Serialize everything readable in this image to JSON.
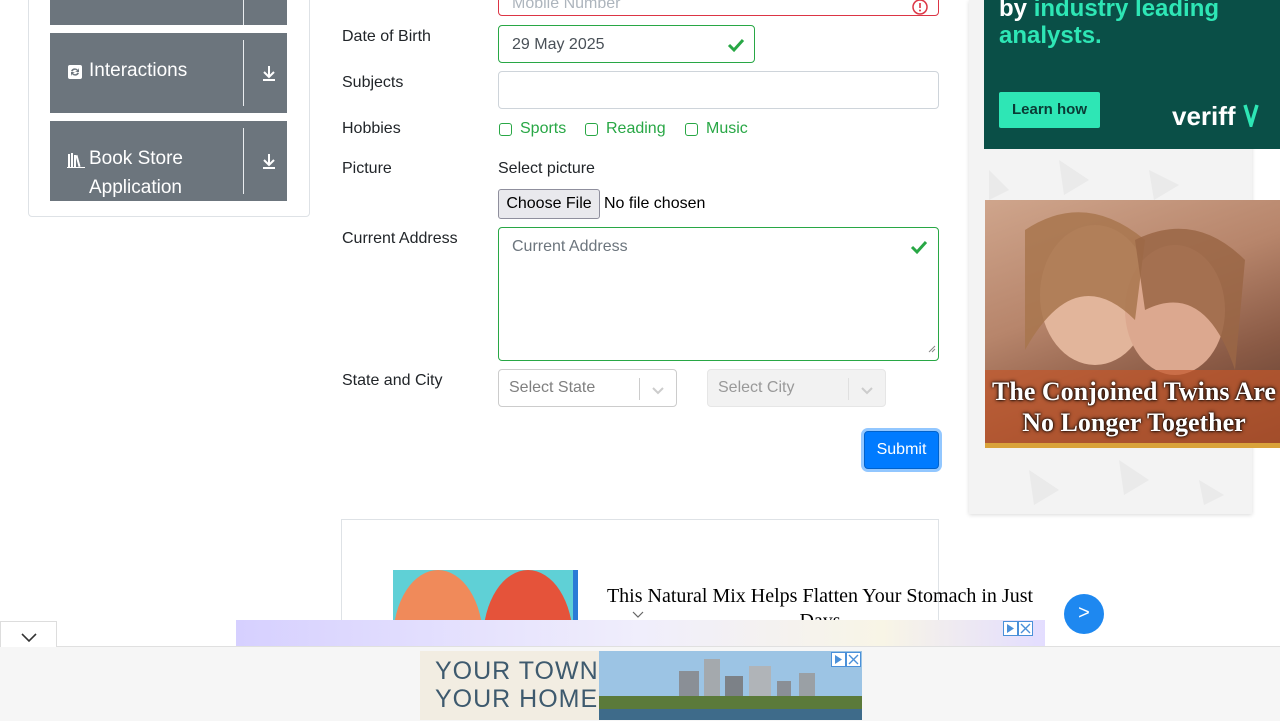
{
  "sidebar": {
    "items": [
      {
        "label": "Interactions",
        "icon": "interactions-icon",
        "action_icon": "download-icon"
      },
      {
        "label_line1": "Book Store",
        "label_line2": "Application",
        "icon": "book-store-icon",
        "action_icon": "download-icon"
      }
    ]
  },
  "form": {
    "mobile": {
      "placeholder": "Mobile Number"
    },
    "dob": {
      "label": "Date of Birth",
      "value": "29 May 2025"
    },
    "subjects": {
      "label": "Subjects",
      "value": ""
    },
    "hobbies": {
      "label": "Hobbies",
      "options": [
        "Sports",
        "Reading",
        "Music"
      ]
    },
    "picture": {
      "label": "Picture",
      "hint": "Select picture",
      "button": "Choose File",
      "status": "No file chosen"
    },
    "address": {
      "label": "Current Address",
      "placeholder": "Current Address"
    },
    "state_city": {
      "label": "State and City",
      "state_placeholder": "Select State",
      "city_placeholder": "Select City"
    },
    "submit": "Submit"
  },
  "ads": {
    "veriff": {
      "line1_prefix": "by ",
      "line1_highlight": "industry leading",
      "line2": "analysts.",
      "cta": "Learn how",
      "brand": "veriff"
    },
    "twins": {
      "headline": "The Conjoined Twins Are No Longer Together"
    },
    "native": {
      "headline": "This Natural Mix Helps Flatten Your Stomach in Just Days",
      "next": ">"
    },
    "banner": {
      "line1": "YOUR TOWN",
      "line2": "YOUR HOME"
    }
  },
  "colors": {
    "valid": "#28a745",
    "invalid": "#dc3545",
    "primary": "#007bff",
    "sidebar": "#6c757d",
    "veriff_bg": "#0a4f47",
    "veriff_accent": "#2ee6b5"
  }
}
